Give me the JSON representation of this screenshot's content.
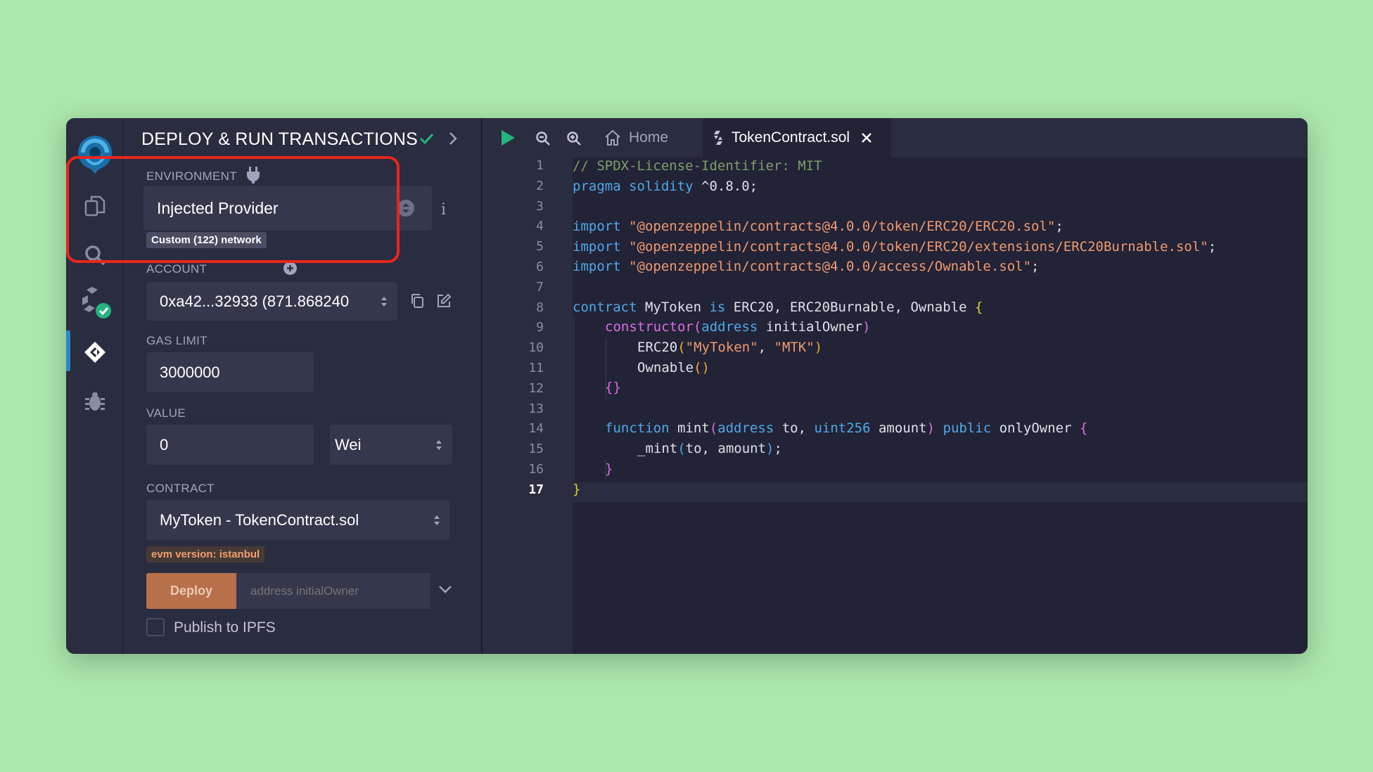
{
  "panel": {
    "title": "DEPLOY & RUN TRANSACTIONS",
    "environment_label": "ENVIRONMENT",
    "environment_value": "Injected Provider",
    "network_badge": "Custom (122) network",
    "info_glyph": "i",
    "account_label": "ACCOUNT",
    "account_value": "0xa42...32933 (871.868240",
    "gas_limit_label": "GAS LIMIT",
    "gas_limit_value": "3000000",
    "value_label": "VALUE",
    "value_value": "0",
    "value_unit": "Wei",
    "contract_label": "CONTRACT",
    "contract_value": "MyToken - TokenContract.sol",
    "evm_badge": "evm version: istanbul",
    "deploy_label": "Deploy",
    "deploy_param_placeholder": "address initialOwner",
    "publish_label": "Publish to IPFS"
  },
  "editor": {
    "tabs": [
      {
        "label": "Home",
        "icon": "home-icon"
      },
      {
        "label": "TokenContract.sol",
        "icon": "file-icon",
        "active": true
      }
    ],
    "active_line": 17,
    "line_numbers": [
      "1",
      "2",
      "3",
      "4",
      "5",
      "6",
      "7",
      "8",
      "9",
      "10",
      "11",
      "12",
      "13",
      "14",
      "15",
      "16",
      "17"
    ],
    "code": {
      "l1": "// SPDX-License-Identifier: MIT",
      "l2_kw": "pragma solidity",
      "l2_rest": " ^0.8.0;",
      "l4_kw": "import",
      "l4_str": "\"@openzeppelin/contracts@4.0.0/token/ERC20/ERC20.sol\"",
      "l5_kw": "import",
      "l5_str": "\"@openzeppelin/contracts@4.0.0/token/ERC20/extensions/ERC20Burnable.sol\"",
      "l6_kw": "import",
      "l6_str": "\"@openzeppelin/contracts@4.0.0/access/Ownable.sol\"",
      "semi": ";",
      "l8_kw": "contract",
      "l8_name": " MyToken ",
      "l8_is": "is",
      "l8_rest": " ERC20, ERC20Burnable, Ownable ",
      "l8_brace": "{",
      "l9_kw": "constructor",
      "l9_p1": "(",
      "l9_type": "address",
      "l9_arg": " initialOwner",
      "l9_p2": ")",
      "l10_name": "ERC20",
      "l10_p1": "(",
      "l10_s1": "\"MyToken\"",
      "l10_c": ", ",
      "l10_s2": "\"MTK\"",
      "l10_p2": ")",
      "l11_name": "Ownable",
      "l11_p": "()",
      "l12": "{}",
      "l14_kw": "function",
      "l14_name": " mint",
      "l14_p1": "(",
      "l14_t1": "address",
      "l14_a1": " to, ",
      "l14_t2": "uint256",
      "l14_a2": " amount",
      "l14_p2": ")",
      "l14_pub": " public",
      "l14_mod": " onlyOwner ",
      "l14_brace": "{",
      "l15_name": "_mint",
      "l15_p1": "(",
      "l15_args": "to, amount",
      "l15_p2": ")",
      "l15_semi": ";",
      "l16": "}",
      "l17": "}"
    }
  },
  "colors": {
    "accent": "#2c87c5",
    "deploy": "#b8714a",
    "highlight": "#e8261f",
    "success": "#24b47e"
  }
}
